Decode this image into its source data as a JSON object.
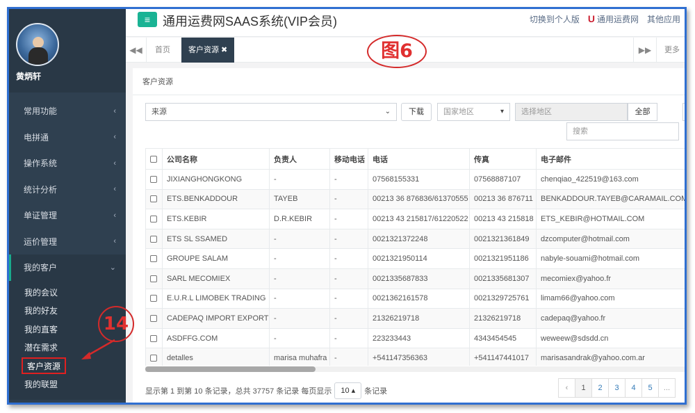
{
  "sidebar": {
    "username": "黄炳轩",
    "items": [
      {
        "label": "常用功能",
        "chev": "‹"
      },
      {
        "label": "电拼通",
        "chev": "‹"
      },
      {
        "label": "操作系统",
        "chev": "‹"
      },
      {
        "label": "统计分析",
        "chev": "‹"
      },
      {
        "label": "单证管理",
        "chev": "‹"
      },
      {
        "label": "运价管理",
        "chev": "‹"
      }
    ],
    "open_item": {
      "label": "我的客户",
      "chev": "⌄"
    },
    "subitems": [
      "我的会议",
      "我的好友",
      "我的直客",
      "潜在需求",
      "客户资源",
      "我的联盟"
    ]
  },
  "topbar": {
    "menu_icon": "≡",
    "title": "通用运费网SAAS系统(VIP会员)",
    "links": [
      "切换到个人版",
      "通用运费网",
      "其他应用"
    ],
    "logo_letter": "U"
  },
  "tabs": {
    "left_nav": "◀◀",
    "home": "首页",
    "current": "客户资源 ✖",
    "right_nav": "▶▶",
    "more": "更多"
  },
  "annotations": {
    "fig": "图6",
    "step": "14"
  },
  "panel": {
    "breadcrumb": "客户资源",
    "filters": {
      "source": "来源",
      "download": "下载",
      "country": "国家地区",
      "region_placeholder": "选择地区",
      "all": "全部",
      "search_placeholder": "搜索"
    }
  },
  "table": {
    "headers": [
      "公司名称",
      "负责人",
      "移动电话",
      "电话",
      "传真",
      "电子邮件"
    ],
    "rows": [
      [
        "JIXIANGHONGKONG",
        "-",
        "-",
        "07568155331",
        "07568887107",
        "chenqiao_422519@163.com"
      ],
      [
        "ETS.BENKADDOUR",
        "TAYEB",
        "-",
        "00213 36 876836/61370555",
        "00213 36 876711",
        "BENKADDOUR.TAYEB@CARAMAIL.COM"
      ],
      [
        "ETS.KEBIR",
        "D.R.KEBIR",
        "-",
        "00213 43 215817/61220522",
        "00213 43 215818",
        "ETS_KEBIR@HOTMAIL.COM"
      ],
      [
        "ETS SL SSAMED",
        "-",
        "-",
        "0021321372248",
        "0021321361849",
        "dzcomputer@hotmail.com"
      ],
      [
        "GROUPE SALAM",
        "-",
        "-",
        "0021321950114",
        "0021321951186",
        "nabyle-souami@hotmail.com"
      ],
      [
        "SARL MECOMIEX",
        "-",
        "-",
        "0021335687833",
        "0021335681307",
        "mecomiex@yahoo.fr"
      ],
      [
        "E.U.R.L LIMOBEK TRADING",
        "-",
        "-",
        "0021362161578",
        "0021329725761",
        "limam66@yahoo.com"
      ],
      [
        "CADEPAQ IMPORT EXPORT",
        "-",
        "-",
        "21326219718",
        "21326219718",
        "cadepaq@yahoo.fr"
      ],
      [
        "ASDFFG.COM",
        "-",
        "-",
        "223233443",
        "4343454545",
        "weweew@sdsdd.cn"
      ],
      [
        "detalles",
        "marisa muhafra",
        "-",
        "+541147356363",
        "+541147441017",
        "marisasandrak@yahoo.com.ar"
      ]
    ]
  },
  "pagination": {
    "info": "显示第 1 到第 10 条记录，总共 37757 条记录 每页显示",
    "page_size": "10 ▴",
    "suffix": "条记录",
    "prev": "‹",
    "pages": [
      "1",
      "2",
      "3",
      "4",
      "5",
      "..."
    ]
  }
}
